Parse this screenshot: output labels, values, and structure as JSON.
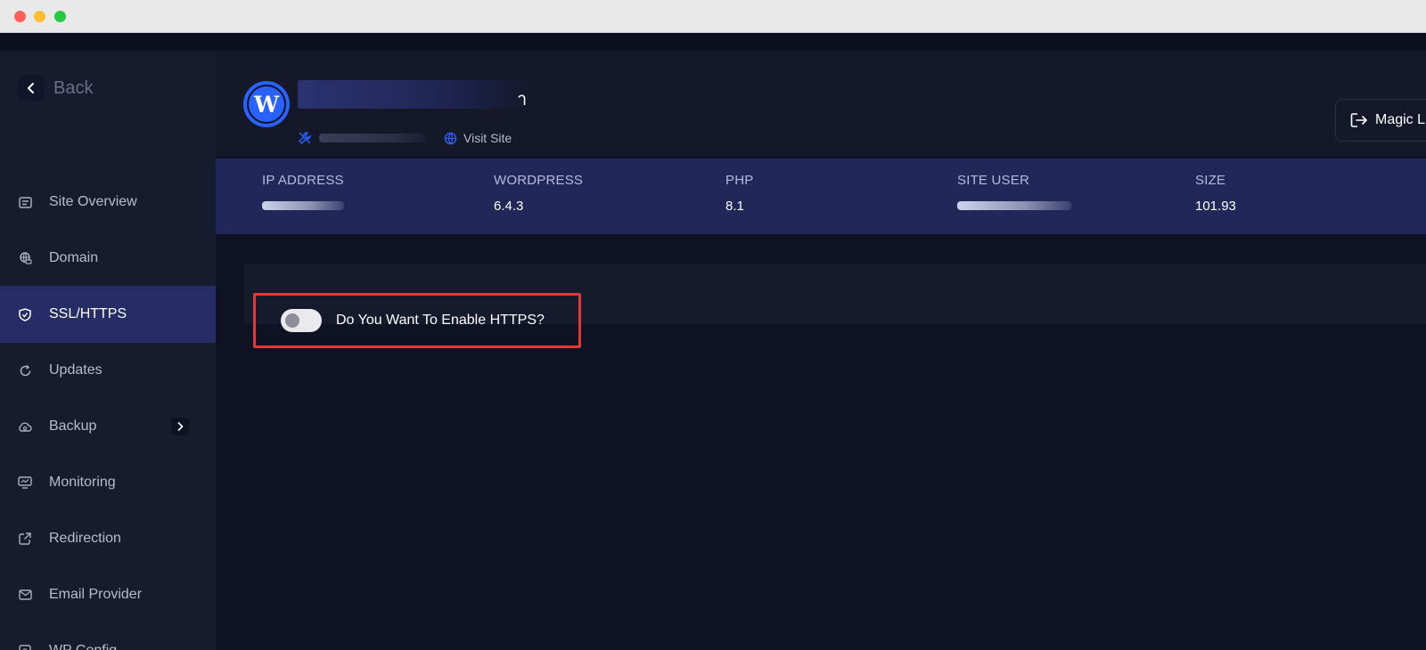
{
  "window": {
    "controls": [
      "close",
      "minimize",
      "zoom"
    ]
  },
  "sidebar": {
    "back_label": "Back",
    "items": [
      {
        "label": "Site Overview",
        "icon": "site-overview-icon",
        "active": false
      },
      {
        "label": "Domain",
        "icon": "domain-icon",
        "active": false
      },
      {
        "label": "SSL/HTTPS",
        "icon": "shield-icon",
        "active": true
      },
      {
        "label": "Updates",
        "icon": "refresh-icon",
        "active": false
      },
      {
        "label": "Backup",
        "icon": "backup-icon",
        "active": false,
        "has_submenu": true
      },
      {
        "label": "Monitoring",
        "icon": "monitor-icon",
        "active": false
      },
      {
        "label": "Redirection",
        "icon": "external-link-icon",
        "active": false
      },
      {
        "label": "Email Provider",
        "icon": "mail-icon",
        "active": false
      },
      {
        "label": "WP Config",
        "icon": "config-icon",
        "active": false
      }
    ]
  },
  "header": {
    "site_title_visible_end": "า",
    "visit_site_label": "Visit Site",
    "magic_login_label": "Magic L"
  },
  "info": {
    "ip_address": {
      "label": "IP ADDRESS",
      "value": ""
    },
    "wordpress": {
      "label": "WORDPRESS",
      "value": "6.4.3"
    },
    "php": {
      "label": "PHP",
      "value": "8.1"
    },
    "site_user": {
      "label": "SITE USER",
      "value": ""
    },
    "size": {
      "label": "SIZE",
      "value": "101.93"
    }
  },
  "ssl": {
    "toggle_label": "Do You Want To Enable HTTPS?",
    "enabled": false
  },
  "colors": {
    "accent": "#2a62ff",
    "active_nav": "#252c66",
    "highlight_border": "#e03a33"
  }
}
